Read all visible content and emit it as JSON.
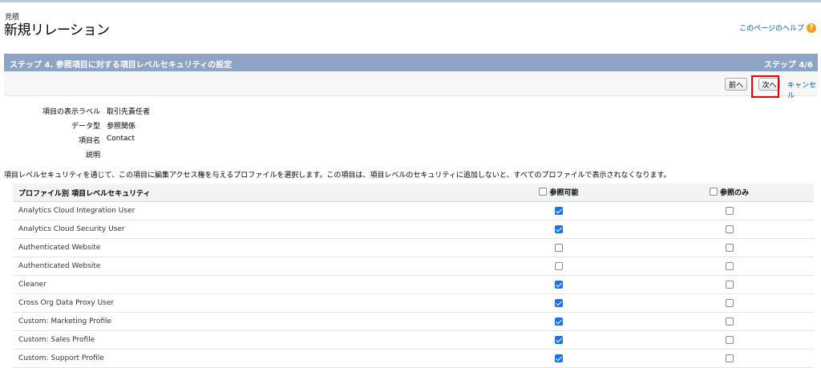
{
  "header": {
    "eyebrow": "見積",
    "title": "新規リレーション",
    "help_label": "このページのヘルプ"
  },
  "step": {
    "title": "ステップ 4. 参照項目に対する項目レベルセキュリティの設定",
    "count": "ステップ 4/6"
  },
  "buttons": {
    "prev": "前へ",
    "next": "次へ",
    "cancel": "キャンセル"
  },
  "field_info": [
    {
      "label": "項目の表示ラベル",
      "value": "取引先責任者"
    },
    {
      "label": "データ型",
      "value": "参照関係"
    },
    {
      "label": "項目名",
      "value": "Contact"
    },
    {
      "label": "説明",
      "value": ""
    }
  ],
  "description": "項目レベルセキュリティを通じて、この項目に編集アクセス権を与えるプロファイルを選択します。この項目は、項目レベルのセキュリティに追加しないと、すべてのプロファイルで表示されなくなります。",
  "table": {
    "headers": {
      "profile": "プロファイル別 項目レベルセキュリティ",
      "visible": "参照可能",
      "readonly": "参照のみ"
    },
    "header_visible_checked": false,
    "header_readonly_checked": false,
    "rows": [
      {
        "name": "Analytics Cloud Integration User",
        "visible": true,
        "readonly": false
      },
      {
        "name": "Analytics Cloud Security User",
        "visible": true,
        "readonly": false
      },
      {
        "name": "Authenticated Website",
        "visible": false,
        "readonly": false
      },
      {
        "name": "Authenticated Website",
        "visible": false,
        "readonly": false
      },
      {
        "name": "Cleaner",
        "visible": true,
        "readonly": false
      },
      {
        "name": "Cross Org Data Proxy User",
        "visible": true,
        "readonly": false
      },
      {
        "name": "Custom: Marketing Profile",
        "visible": true,
        "readonly": false
      },
      {
        "name": "Custom: Sales Profile",
        "visible": true,
        "readonly": false
      },
      {
        "name": "Custom: Support Profile",
        "visible": true,
        "readonly": false
      }
    ]
  },
  "colors": {
    "step_bar": "#8ea4c6",
    "link": "#015ba7",
    "highlight": "#e60000",
    "checkbox_on": "#1a73e8"
  },
  "icons": {
    "help": "question-circle-icon"
  }
}
